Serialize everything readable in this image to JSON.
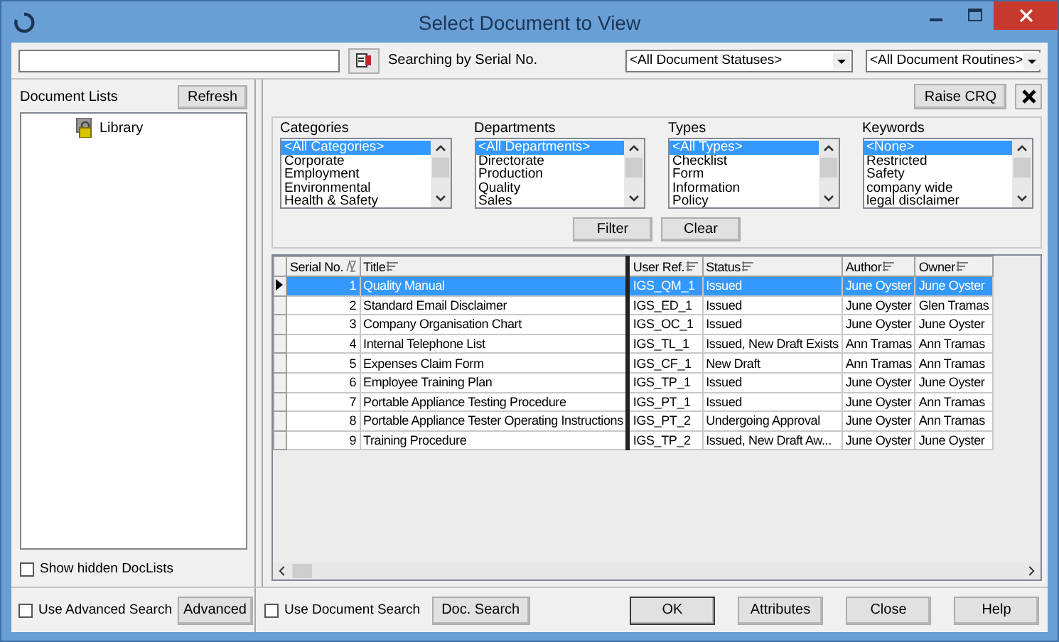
{
  "window": {
    "title": "Select Document to View"
  },
  "search": {
    "mode_label": "Searching by Serial No."
  },
  "status_filter": {
    "value": "<All Document Statuses>"
  },
  "routine_filter": {
    "value": "<All Document Routines>"
  },
  "document_lists": {
    "label": "Document Lists",
    "refresh_button": "Refresh",
    "items": [
      {
        "label": "Library",
        "selected": false
      }
    ],
    "show_hidden": {
      "label": "Show hidden DocLists",
      "checked": false
    }
  },
  "raise_button": "Raise CRQ",
  "filters": [
    {
      "label": "Categories",
      "items": [
        {
          "label": "<All Categories>",
          "selected": true
        },
        {
          "label": "Corporate",
          "selected": false
        },
        {
          "label": "Employment",
          "selected": false
        },
        {
          "label": "Environmental",
          "selected": false
        },
        {
          "label": "Health & Safety",
          "selected": false
        }
      ]
    },
    {
      "label": "Departments",
      "items": [
        {
          "label": "<All Departments>",
          "selected": true
        },
        {
          "label": "Directorate",
          "selected": false
        },
        {
          "label": "Production",
          "selected": false
        },
        {
          "label": "Quality",
          "selected": false
        },
        {
          "label": "Sales",
          "selected": false
        }
      ]
    },
    {
      "label": "Types",
      "items": [
        {
          "label": "<All Types>",
          "selected": true
        },
        {
          "label": "Checklist",
          "selected": false
        },
        {
          "label": "Form",
          "selected": false
        },
        {
          "label": "Information",
          "selected": false
        },
        {
          "label": "Policy",
          "selected": false
        }
      ]
    },
    {
      "label": "Keywords",
      "items": [
        {
          "label": "<None>",
          "selected": true
        },
        {
          "label": "Restricted",
          "selected": false
        },
        {
          "label": "Safety",
          "selected": false
        },
        {
          "label": "company wide",
          "selected": false
        },
        {
          "label": "legal disclaimer",
          "selected": false
        }
      ]
    }
  ],
  "filter_buttons": [
    "Filter",
    "Clear"
  ],
  "table": {
    "columns": [
      {
        "label": "Serial No.",
        "sorted": true,
        "pinned": false
      },
      {
        "label": "Title",
        "sorted": false,
        "pinned": true
      },
      {
        "label": "User Ref.",
        "sorted": false,
        "pinned": false
      },
      {
        "label": "Status",
        "sorted": false,
        "pinned": false
      },
      {
        "label": "Author",
        "sorted": false,
        "pinned": false
      },
      {
        "label": "Owner",
        "sorted": false,
        "pinned": false
      }
    ],
    "rows": [
      {
        "selected": true,
        "cells": [
          "1",
          "Quality Manual",
          "IGS_QM_1",
          "Issued",
          "June Oyster",
          "June Oyster"
        ]
      },
      {
        "selected": false,
        "cells": [
          "2",
          "Standard Email Disclaimer",
          "IGS_ED_1",
          "Issued",
          "June Oyster",
          "Glen Tramas"
        ]
      },
      {
        "selected": false,
        "cells": [
          "3",
          "Company Organisation Chart",
          "IGS_OC_1",
          "Issued",
          "June Oyster",
          "June Oyster"
        ]
      },
      {
        "selected": false,
        "cells": [
          "4",
          "Internal Telephone List",
          "IGS_TL_1",
          "Issued, New Draft Exists",
          "Ann Tramas",
          "Ann Tramas"
        ]
      },
      {
        "selected": false,
        "cells": [
          "5",
          "Expenses Claim Form",
          "IGS_CF_1",
          "New Draft",
          "Ann Tramas",
          "Ann Tramas"
        ]
      },
      {
        "selected": false,
        "cells": [
          "6",
          "Employee Training Plan",
          "IGS_TP_1",
          "Issued",
          "June Oyster",
          "June Oyster"
        ]
      },
      {
        "selected": false,
        "cells": [
          "7",
          "Portable Appliance Testing Procedure",
          "IGS_PT_1",
          "Issued",
          "June Oyster",
          "Ann Tramas"
        ]
      },
      {
        "selected": false,
        "cells": [
          "8",
          "Portable Appliance Tester Operating Instructions",
          "IGS_PT_2",
          "Undergoing Approval",
          "June Oyster",
          "Ann Tramas"
        ]
      },
      {
        "selected": false,
        "cells": [
          "9",
          "Training Procedure",
          "IGS_TP_2",
          "Issued, New Draft Aw...",
          "June Oyster",
          "June Oyster"
        ]
      }
    ]
  },
  "footer": {
    "advanced_search": {
      "label": "Use Advanced Search",
      "checked": false
    },
    "advanced_button": "Advanced",
    "document_search": {
      "label": "Use Document Search",
      "checked": false
    },
    "doc_search_button": "Doc. Search",
    "buttons": [
      {
        "label": "OK",
        "default": true
      },
      {
        "label": "Attributes",
        "default": false
      },
      {
        "label": "Close",
        "default": false
      },
      {
        "label": "Help",
        "default": false
      }
    ]
  }
}
